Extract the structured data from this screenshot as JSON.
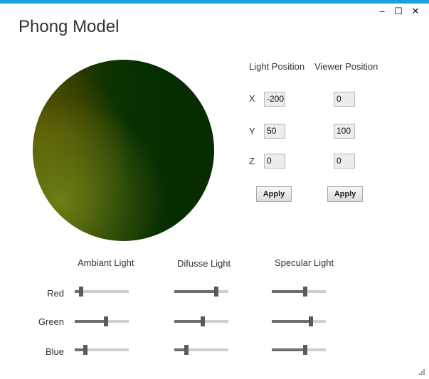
{
  "window": {
    "title": "Phong Model",
    "accent": "#1ba1e2",
    "controls": {
      "minimize": "–",
      "maximize": "☐",
      "close": "✕"
    }
  },
  "positions": {
    "light_header": "Light Position",
    "viewer_header": "Viewer Position",
    "axes": [
      "X",
      "Y",
      "Z"
    ],
    "light": {
      "x": "-200",
      "y": "50",
      "z": "0"
    },
    "viewer": {
      "x": "0",
      "y": "100",
      "z": "0"
    },
    "apply_light": "Apply",
    "apply_viewer": "Apply"
  },
  "lighting": {
    "headers": {
      "ambient": "Ambiant Light",
      "diffuse": "Difusse Light",
      "specular": "Specular Light"
    },
    "rows": [
      "Red",
      "Green",
      "Blue"
    ],
    "ambient": {
      "red": 0.12,
      "green": 0.58,
      "blue": 0.2
    },
    "diffuse": {
      "red": 0.78,
      "green": 0.52,
      "blue": 0.22
    },
    "specular": {
      "red": 0.62,
      "green": 0.73,
      "blue": 0.62
    }
  },
  "icons": {
    "resize_grip": "resize-grip-icon"
  }
}
